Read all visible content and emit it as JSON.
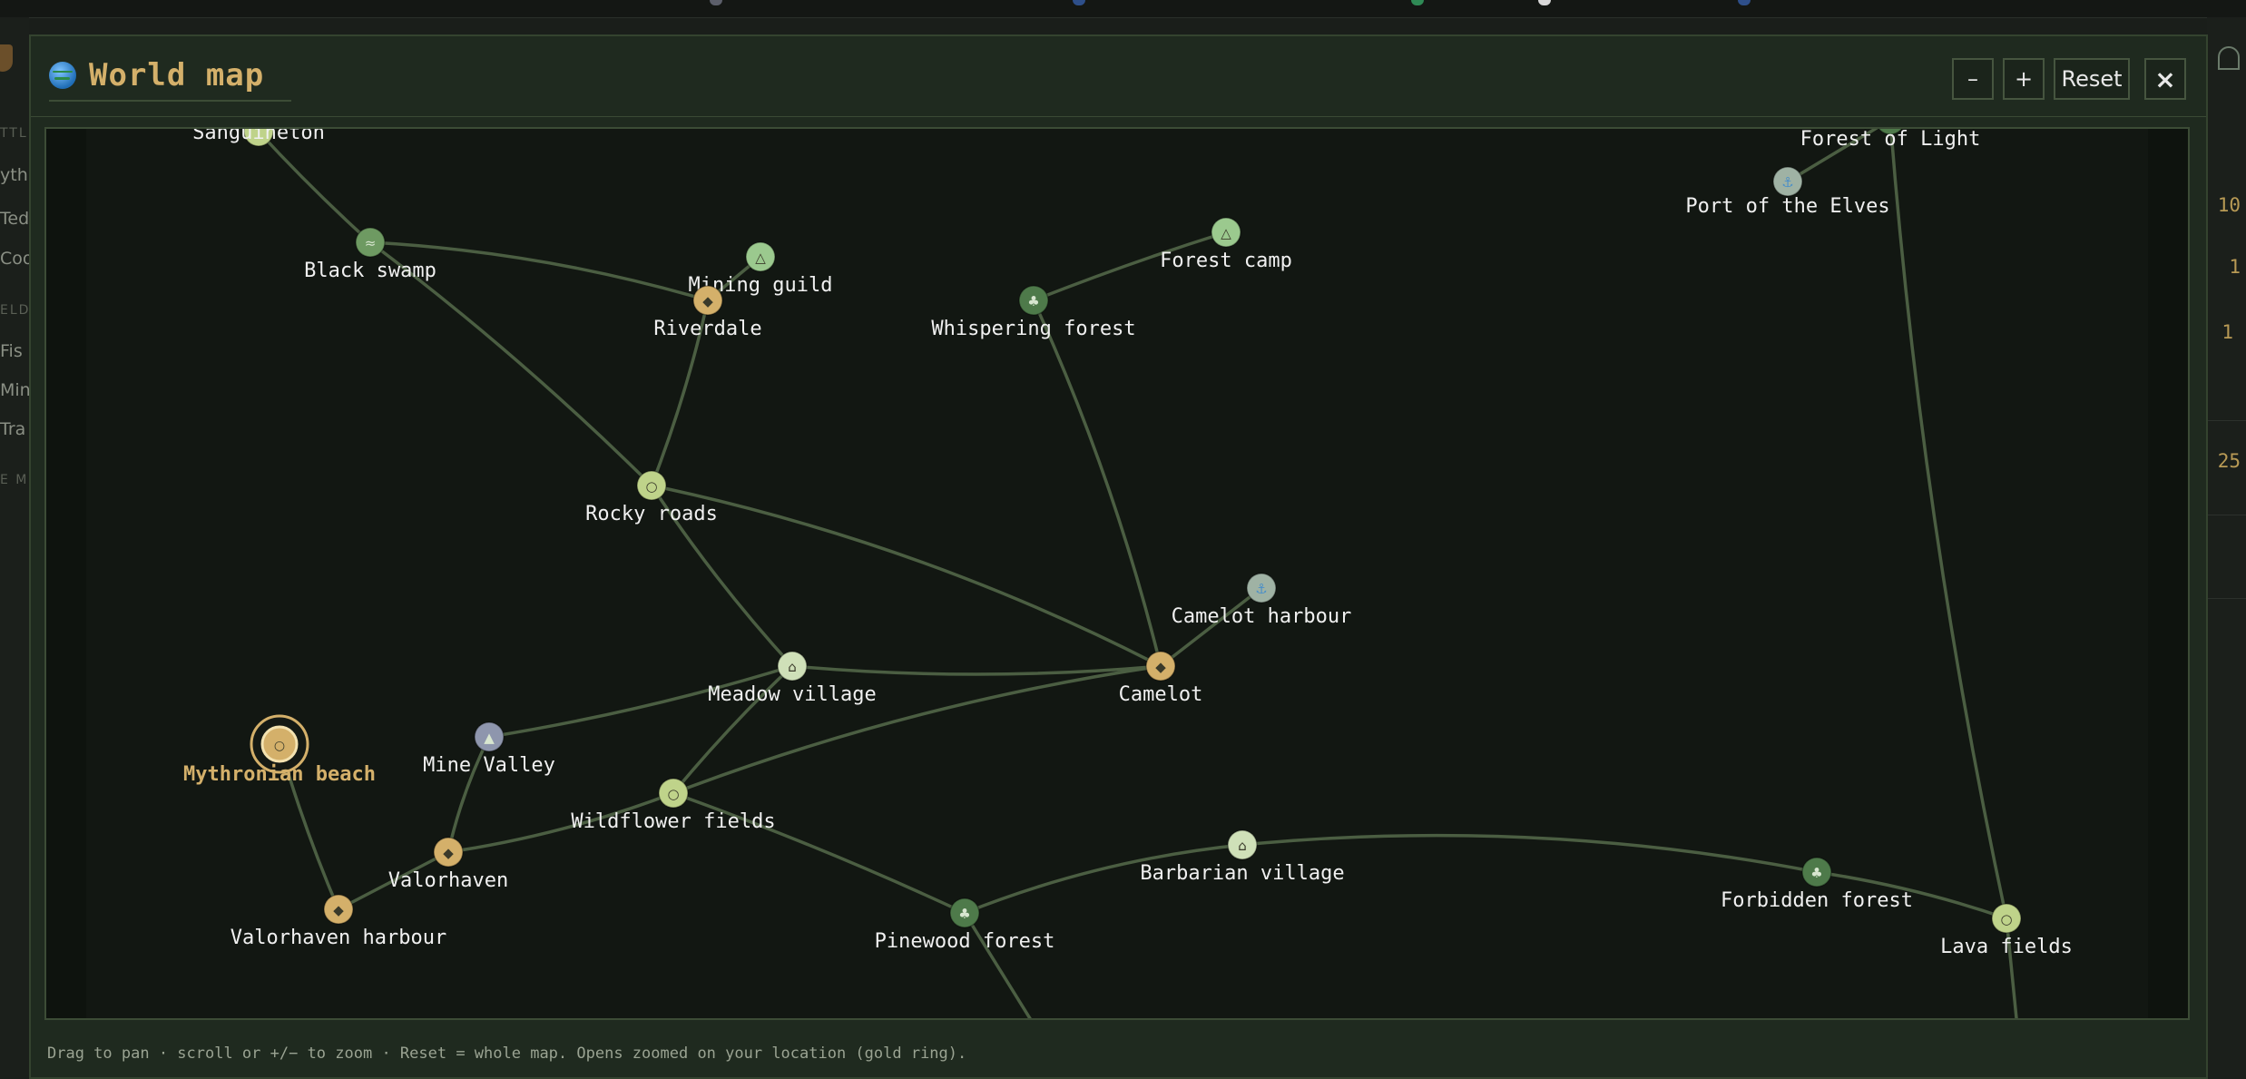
{
  "modal": {
    "title": "World map",
    "zoom_out_label": "–",
    "zoom_in_label": "+",
    "reset_label": "Reset",
    "close_label": "×",
    "hint": "Drag to pan · scroll or +/− to zoom · Reset = whole map. Opens zoomed on your location (gold ring)."
  },
  "map": {
    "current_location": "Mythronian beach",
    "colors": {
      "edge": "#4b5e42",
      "town": "#d4b06a",
      "forest": "#4e7a4a",
      "swamp": "#6e9a62",
      "camp": "#9bc98e",
      "field": "#bfd38a",
      "village": "#cfe0b8",
      "mine": "#8e96ad",
      "harbour_port": "#9fb2a4",
      "current_ring": "#d4b06a",
      "label": "#f0f0f0",
      "current_label": "#d4b06a"
    },
    "nodes": [
      {
        "id": "sanguineton",
        "name": "Sanguineton",
        "kind": "field",
        "icon": ""
      },
      {
        "id": "black-swamp",
        "name": "Black swamp",
        "kind": "swamp",
        "icon": "≈"
      },
      {
        "id": "mining-guild",
        "name": "Mining guild",
        "kind": "camp",
        "icon": "△"
      },
      {
        "id": "riverdale",
        "name": "Riverdale",
        "kind": "town",
        "icon": "◆"
      },
      {
        "id": "forest-camp",
        "name": "Forest camp",
        "kind": "camp",
        "icon": "△"
      },
      {
        "id": "whispering-forest",
        "name": "Whispering forest",
        "kind": "forest",
        "icon": "♣"
      },
      {
        "id": "forest-of-light",
        "name": "Forest of Light",
        "kind": "forest",
        "icon": ""
      },
      {
        "id": "port-of-the-elves",
        "name": "Port of the Elves",
        "kind": "harbour_port",
        "icon": "⚓"
      },
      {
        "id": "rocky-roads",
        "name": "Rocky roads",
        "kind": "field",
        "icon": "○"
      },
      {
        "id": "camelot-harbour",
        "name": "Camelot harbour",
        "kind": "harbour_port",
        "icon": "⚓"
      },
      {
        "id": "meadow-village",
        "name": "Meadow village",
        "kind": "village",
        "icon": "⌂"
      },
      {
        "id": "camelot",
        "name": "Camelot",
        "kind": "town",
        "icon": "◆"
      },
      {
        "id": "mythronian-beach",
        "name": "Mythronian beach",
        "kind": "current",
        "icon": "○"
      },
      {
        "id": "mine-valley",
        "name": "Mine Valley",
        "kind": "mine",
        "icon": "▲"
      },
      {
        "id": "wildflower-fields",
        "name": "Wildflower fields",
        "kind": "field",
        "icon": "○"
      },
      {
        "id": "valorhaven",
        "name": "Valorhaven",
        "kind": "town",
        "icon": "◆"
      },
      {
        "id": "barbarian-village",
        "name": "Barbarian village",
        "kind": "village",
        "icon": "⌂"
      },
      {
        "id": "forbidden-forest",
        "name": "Forbidden forest",
        "kind": "forest",
        "icon": "♣"
      },
      {
        "id": "valorhaven-harbour",
        "name": "Valorhaven harbour",
        "kind": "town",
        "icon": "◆"
      },
      {
        "id": "pinewood-forest",
        "name": "Pinewood forest",
        "kind": "forest",
        "icon": "♣"
      },
      {
        "id": "lava-fields",
        "name": "Lava fields",
        "kind": "field",
        "icon": "○"
      }
    ],
    "edges": [
      [
        "sanguineton",
        "black-swamp"
      ],
      [
        "black-swamp",
        "riverdale"
      ],
      [
        "black-swamp",
        "rocky-roads"
      ],
      [
        "mining-guild",
        "riverdale"
      ],
      [
        "riverdale",
        "rocky-roads"
      ],
      [
        "forest-camp",
        "whispering-forest"
      ],
      [
        "whispering-forest",
        "camelot"
      ],
      [
        "forest-of-light",
        "port-of-the-elves"
      ],
      [
        "forest-of-light",
        "lava-fields"
      ],
      [
        "rocky-roads",
        "meadow-village"
      ],
      [
        "rocky-roads",
        "camelot"
      ],
      [
        "camelot-harbour",
        "camelot"
      ],
      [
        "meadow-village",
        "camelot"
      ],
      [
        "meadow-village",
        "mine-valley"
      ],
      [
        "meadow-village",
        "wildflower-fields"
      ],
      [
        "wildflower-fields",
        "camelot"
      ],
      [
        "mine-valley",
        "valorhaven"
      ],
      [
        "wildflower-fields",
        "valorhaven"
      ],
      [
        "mythronian-beach",
        "valorhaven-harbour"
      ],
      [
        "valorhaven",
        "valorhaven-harbour"
      ],
      [
        "wildflower-fields",
        "pinewood-forest"
      ],
      [
        "pinewood-forest",
        "barbarian-village"
      ],
      [
        "barbarian-village",
        "forbidden-forest"
      ],
      [
        "forbidden-forest",
        "lava-fields"
      ],
      [
        "pinewood-forest",
        "offscreen-south"
      ],
      [
        "lava-fields",
        "offscreen-south-east"
      ]
    ]
  },
  "background": {
    "left_texts": [
      "TTLE",
      "yth",
      "Ted",
      "Coo",
      "ELD",
      "Fis",
      "Min",
      "Tra",
      "E M"
    ],
    "right_numbers": [
      "10",
      "1",
      "1",
      "25"
    ]
  }
}
